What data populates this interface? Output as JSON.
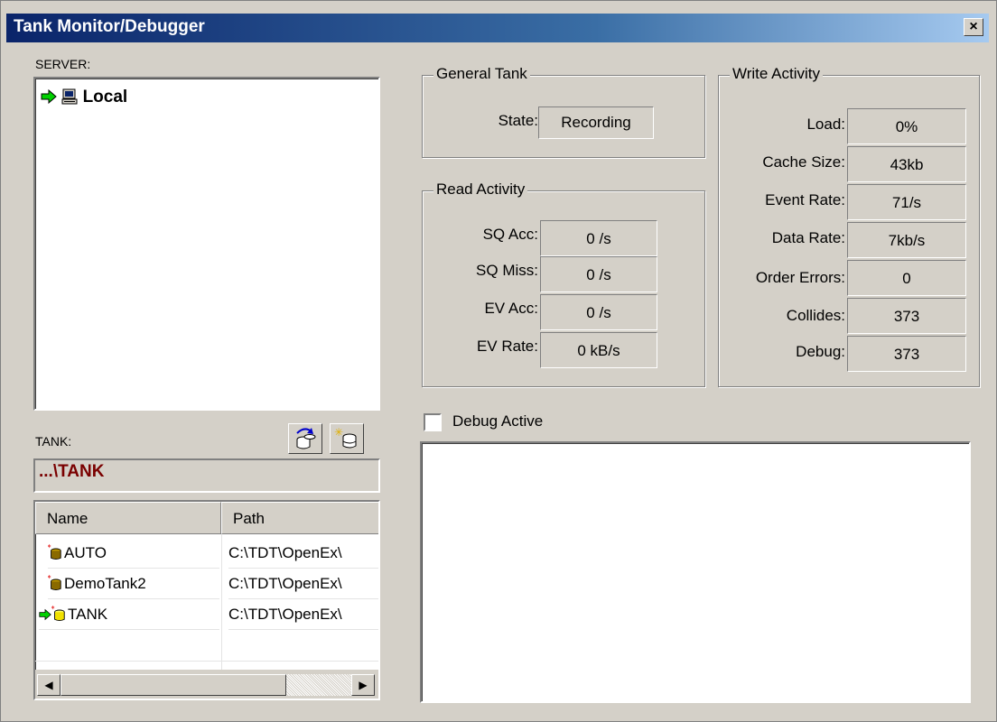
{
  "window": {
    "title": "Tank Monitor/Debugger",
    "close_glyph": "×"
  },
  "server": {
    "label": "SERVER:",
    "items": [
      {
        "label": "Local",
        "icon": "computer-icon",
        "active_marker": "green-arrow-icon"
      }
    ]
  },
  "tank": {
    "label": "TANK:",
    "current_path": "...\\TANK",
    "columns": [
      "Name",
      "Path"
    ],
    "rows": [
      {
        "name": "AUTO",
        "path": "C:\\TDT\\OpenEx\\"
      },
      {
        "name": "DemoTank2",
        "path": "C:\\TDT\\OpenEx\\"
      },
      {
        "name": "TANK",
        "path": "C:\\TDT\\OpenEx\\"
      }
    ]
  },
  "general_tank": {
    "title": "General Tank",
    "state_label": "State:",
    "state_value": "Recording"
  },
  "read_activity": {
    "title": "Read Activity",
    "rows": [
      {
        "label": "SQ Acc:",
        "value": "0 /s"
      },
      {
        "label": "SQ Miss:",
        "value": "0 /s"
      },
      {
        "label": "EV Acc:",
        "value": "0 /s"
      },
      {
        "label": "EV Rate:",
        "value": "0 kB/s"
      }
    ]
  },
  "write_activity": {
    "title": "Write Activity",
    "rows": [
      {
        "label": "Load:",
        "value": "0%"
      },
      {
        "label": "Cache Size:",
        "value": "43kb"
      },
      {
        "label": "Event Rate:",
        "value": "71/s"
      },
      {
        "label": "Data Rate:",
        "value": "7kb/s"
      },
      {
        "label": "Order Errors:",
        "value": "0"
      },
      {
        "label": "Collides:",
        "value": "373"
      },
      {
        "label": "Debug:",
        "value": "373"
      }
    ]
  },
  "debug": {
    "label": "Debug Active",
    "checked": false
  }
}
